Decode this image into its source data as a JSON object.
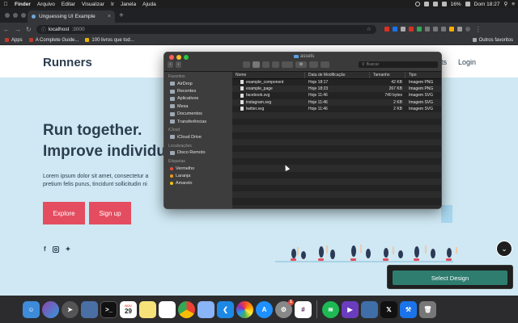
{
  "menubar": {
    "app": "Finder",
    "items": [
      "Arquivo",
      "Editar",
      "Visualizar",
      "Ir",
      "Janela",
      "Ajuda"
    ],
    "battery": "16%",
    "clock": "Dom 18:27"
  },
  "browser": {
    "tab_title": "Unguessing UI Example",
    "url_host": "localhost",
    "url_port": ":3000",
    "bookmarks": [
      "Apps",
      "A Complete Guide...",
      "100 livros que tod..."
    ],
    "bookmarks_right": "Outros favoritos"
  },
  "site": {
    "brand": "Runners",
    "nav_partial": "ts",
    "nav_login": "Login",
    "headline_1": "Run together.",
    "headline_2": "Improve individua",
    "subtext_1": "Lorem ipsum dolor sit amet, consectetur a",
    "subtext_2": "pretium felis purus, tincidunt sollicitudin ni",
    "explore_label": "Explore",
    "signup_label": "Sign up",
    "social": [
      "facebook-icon",
      "instagram-icon",
      "twitter-icon"
    ]
  },
  "finder": {
    "folder_name": "assets",
    "search_placeholder": "Buscar",
    "sidebar": [
      {
        "type": "section",
        "label": "Favoritos"
      },
      {
        "type": "item",
        "label": "AirDrop",
        "icon": "airdrop-icon"
      },
      {
        "type": "item",
        "label": "Recentes",
        "icon": "clock-icon"
      },
      {
        "type": "item",
        "label": "Aplicativos",
        "icon": "apps-icon"
      },
      {
        "type": "item",
        "label": "Mesa",
        "icon": "desktop-icon"
      },
      {
        "type": "item",
        "label": "Documentos",
        "icon": "document-icon"
      },
      {
        "type": "item",
        "label": "Transferências",
        "icon": "download-icon"
      },
      {
        "type": "section",
        "label": "iCloud"
      },
      {
        "type": "item",
        "label": "iCloud Drive",
        "icon": "cloud-icon"
      },
      {
        "type": "section",
        "label": "Localizações"
      },
      {
        "type": "item",
        "label": "Disco Remoto",
        "icon": "disc-icon"
      },
      {
        "type": "section",
        "label": "Etiquetas"
      },
      {
        "type": "tag",
        "label": "Vermelho",
        "color": "#e74c3c"
      },
      {
        "type": "tag",
        "label": "Laranja",
        "color": "#f39c12"
      },
      {
        "type": "tag",
        "label": "Amarelo",
        "color": "#f1c40f"
      }
    ],
    "columns": [
      "Nome",
      "Data de Modificação",
      "Tamanho",
      "Tipo"
    ],
    "files": [
      {
        "name": "example_component",
        "date": "Hoje 18:17",
        "size": "42 KB",
        "kind": "Imagem PNG"
      },
      {
        "name": "example_page",
        "date": "Hoje 18:23",
        "size": "267 KB",
        "kind": "Imagem PNG"
      },
      {
        "name": "facebook.svg",
        "date": "Hoje 11:46",
        "size": "740 bytes",
        "kind": "Imagem SVG"
      },
      {
        "name": "instagram.svg",
        "date": "Hoje 11:46",
        "size": "2 KB",
        "kind": "Imagem SVG"
      },
      {
        "name": "twitter.svg",
        "date": "Hoje 11:46",
        "size": "2 KB",
        "kind": "Imagem SVG"
      }
    ]
  },
  "overlay": {
    "select_design_label": "Select Design"
  },
  "dock": {
    "calendar_month": "NOV",
    "calendar_day": "29",
    "badge_count": "1",
    "apps": [
      "finder",
      "siri",
      "launchpad",
      "preview",
      "terminal",
      "calendar",
      "notes",
      "reminders",
      "chrome",
      "photos-app",
      "vscode",
      "photos",
      "app-store",
      "system-preferences",
      "slack",
      "spotify",
      "prompt",
      "screenshot",
      "x",
      "xcode",
      "trash"
    ]
  },
  "colors": {
    "hero_bg": "#cfe8f3",
    "brand_red": "#e44d5f",
    "select_green": "#2e7d6f",
    "navy": "#2c3e50"
  }
}
